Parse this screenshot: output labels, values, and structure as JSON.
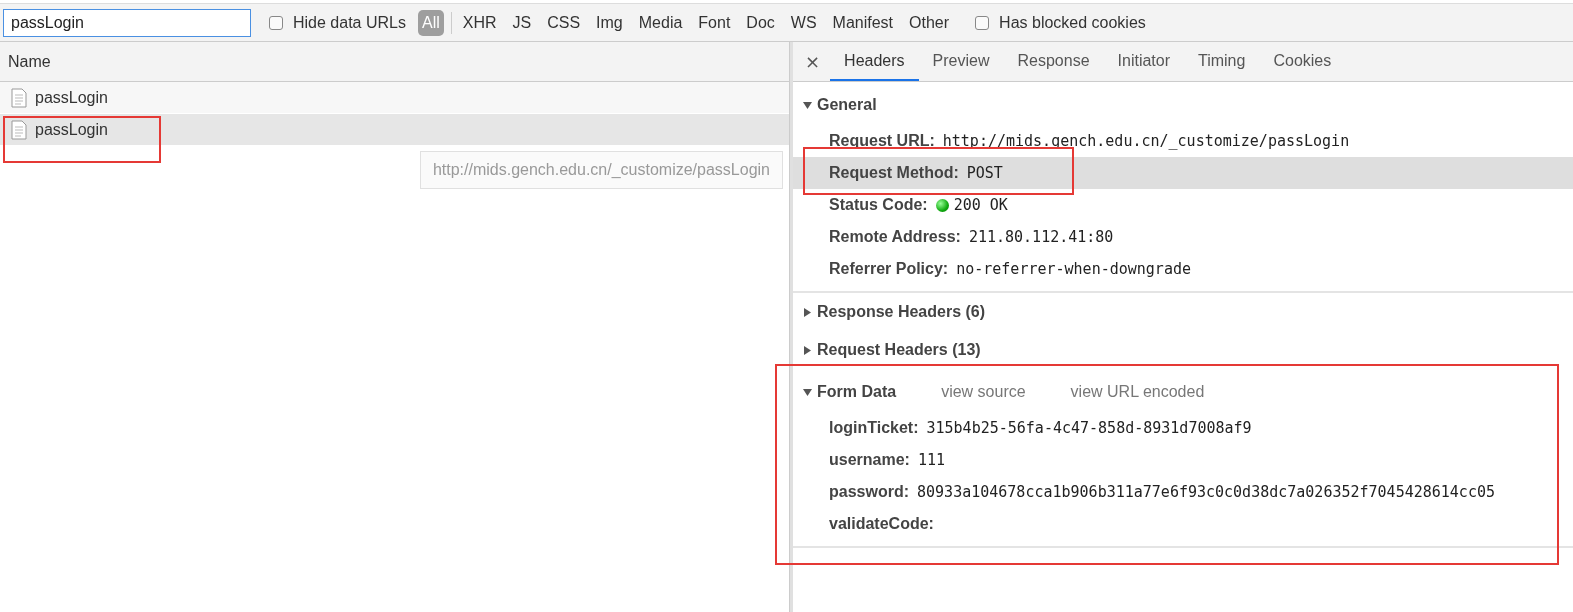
{
  "filter_bar": {
    "search": {
      "value": "passLogin"
    },
    "hide_data_urls": {
      "label": "Hide data URLs",
      "checked": false
    },
    "types": [
      {
        "label": "All",
        "selected": true
      },
      {
        "label": "XHR",
        "selected": false
      },
      {
        "label": "JS",
        "selected": false
      },
      {
        "label": "CSS",
        "selected": false
      },
      {
        "label": "Img",
        "selected": false
      },
      {
        "label": "Media",
        "selected": false
      },
      {
        "label": "Font",
        "selected": false
      },
      {
        "label": "Doc",
        "selected": false
      },
      {
        "label": "WS",
        "selected": false
      },
      {
        "label": "Manifest",
        "selected": false
      },
      {
        "label": "Other",
        "selected": false
      }
    ],
    "has_blocked_cookies": {
      "label": "Has blocked cookies",
      "checked": false
    }
  },
  "requests": {
    "column": "Name",
    "rows": [
      {
        "name": "passLogin",
        "selected": false
      },
      {
        "name": "passLogin",
        "selected": true
      }
    ]
  },
  "tooltip": "http://mids.gench.edu.cn/_customize/passLogin",
  "details": {
    "close": "×",
    "tabs": [
      {
        "label": "Headers",
        "selected": true
      },
      {
        "label": "Preview",
        "selected": false
      },
      {
        "label": "Response",
        "selected": false
      },
      {
        "label": "Initiator",
        "selected": false
      },
      {
        "label": "Timing",
        "selected": false
      },
      {
        "label": "Cookies",
        "selected": false
      }
    ],
    "sections": [
      {
        "title": "General",
        "expanded": true,
        "rows": [
          {
            "key": "Request URL:",
            "value": "http://mids.gench.edu.cn/_customize/passLogin",
            "selected": false
          },
          {
            "key": "Request Method:",
            "value": "POST",
            "selected": true
          },
          {
            "key": "Status Code:",
            "value": "200 OK",
            "kind": "status",
            "selected": false
          },
          {
            "key": "Remote Address:",
            "value": "211.80.112.41:80",
            "selected": false
          },
          {
            "key": "Referrer Policy:",
            "value": "no-referrer-when-downgrade",
            "selected": false
          }
        ]
      },
      {
        "title": "Response Headers (6)",
        "expanded": false
      },
      {
        "title": "Request Headers (13)",
        "expanded": false
      },
      {
        "title": "Form Data",
        "expanded": true,
        "links": [
          "view source",
          "view URL encoded"
        ],
        "rows": [
          {
            "key": "loginTicket:",
            "value": "315b4b25-56fa-4c47-858d-8931d7008af9"
          },
          {
            "key": "username:",
            "value": "111"
          },
          {
            "key": "password:",
            "value": "80933a104678cca1b906b311a77e6f93c0c0d38dc7a026352f7045428614cc05"
          },
          {
            "key": "validateCode:"
          }
        ]
      }
    ]
  }
}
